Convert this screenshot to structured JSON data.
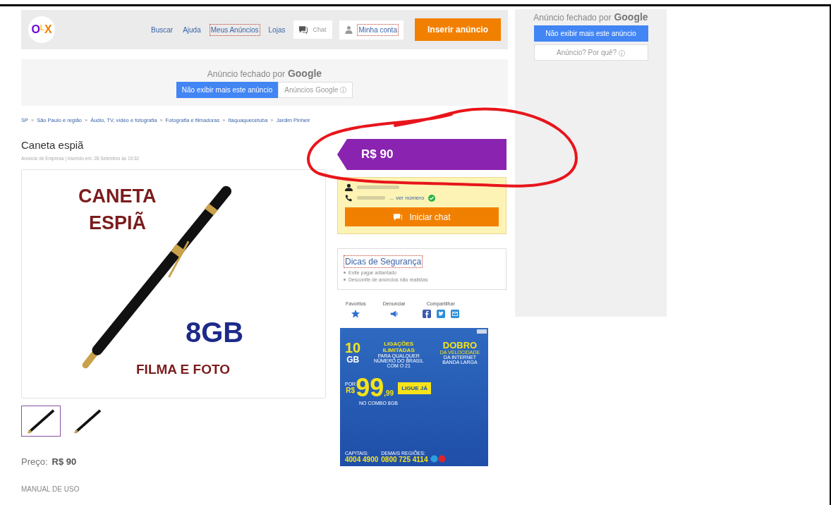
{
  "header": {
    "logo": [
      {
        "letter": "O",
        "color": "#6e0ad6"
      },
      {
        "letter": "L",
        "color": "#f5c518"
      },
      {
        "letter": "X",
        "color": "#f28000"
      }
    ],
    "nav": [
      {
        "label": "Buscar",
        "kind": "link",
        "focused": false
      },
      {
        "label": "Ajuda",
        "kind": "link",
        "focused": false
      },
      {
        "label": "Meus Anúncios",
        "kind": "link",
        "focused": true
      },
      {
        "label": "Lojas",
        "kind": "link",
        "focused": false
      },
      {
        "label": "Chat",
        "kind": "chat",
        "focused": false
      },
      {
        "label": "Minha conta",
        "kind": "account",
        "focused": true
      }
    ],
    "cta": "Inserir anúncio"
  },
  "top_ad": {
    "closed_by": "Anúncio fechado por",
    "brand": "Google",
    "hide_button": "Não exibir mais este anúncio",
    "info_button": "Anúncios Google"
  },
  "side_ad": {
    "closed_by": "Anúncio fechado por",
    "brand": "Google",
    "hide_button": "Não exibir mais este anúncio",
    "info_button": "Anúncio? Por quê?"
  },
  "breadcrumb": {
    "separator": "»",
    "items": [
      "SP",
      "São Paulo e região",
      "Áudio, TV, vídeo e fotografia",
      "Fotografia e filmadoras",
      "Itaquaquecetuba",
      "Jardim Pinheir"
    ]
  },
  "listing": {
    "title": "Caneta espiã",
    "meta": "Anúncio de Empresa | Inserido em: 28 Setembro às 19:32",
    "image_text": {
      "line_1": "CANETA",
      "line_2": "ESPIÃ",
      "capacity": "8GB",
      "caption": "FILMA E FOTO"
    },
    "thumbnails": [
      {
        "selected": true
      },
      {
        "selected": false
      }
    ],
    "price_label": "Preço:",
    "price": "R$ 90",
    "description": "MANUAL DE USO"
  },
  "price_tag": "R$ 90",
  "seller": {
    "phone_link": "... ver número",
    "verified": true,
    "chat_button": "Iniciar chat"
  },
  "tips": {
    "title": "Dicas de Segurança",
    "focused": true,
    "items": [
      "Evite pagar adiantado",
      "Desconfie de anúncios não realistas"
    ]
  },
  "actions": [
    {
      "label": "Favoritos",
      "kind": "star"
    },
    {
      "label": "Denunciar",
      "kind": "megaphone"
    },
    {
      "label": "Compartilhar",
      "kind": "share"
    }
  ],
  "banner": {
    "data": "10",
    "unit": "GB",
    "calls_title": "LIGAÇÕES ILIMITADAS",
    "calls_text": "PARA QUALQUER NÚMERO DO BRASIL COM O 21",
    "speed_title": "DOBRO",
    "speed_sub": "DA VELOCIDADE",
    "speed_text": "DA INTERNET BANDA LARGA",
    "price_prefix": "POR",
    "currency": "R$",
    "price": "99",
    "cents": ",99",
    "cta": "LIGUE JÁ",
    "combo": "NO COMBO 8GB",
    "capitals_label": "CAPITAIS:",
    "capitals_phone": "4004 4900",
    "regions_label": "DEMAIS REGIÕES:",
    "regions_phone": "0800 725 4114"
  }
}
